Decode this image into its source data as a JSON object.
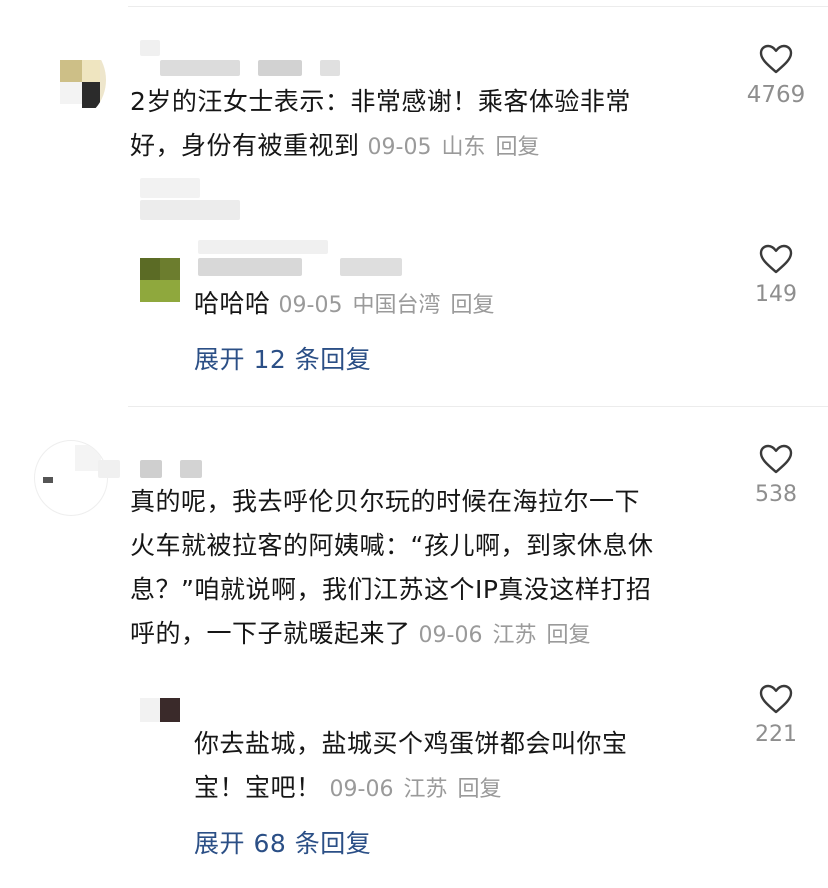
{
  "comments": [
    {
      "text": "2岁的汪女士表示：非常感谢！乘客体验非常好，身份有被重视到",
      "line1": "2岁的汪女士表示：非常感谢！乘客体验非常",
      "line2": "好，身份有被重视到",
      "date": "09-05",
      "location": "山东",
      "reply_label": "回复",
      "likes": "4769",
      "reply": {
        "text": "哈哈哈",
        "date": "09-05",
        "location": "中国台湾",
        "reply_label": "回复",
        "likes": "149"
      },
      "expand_label": "展开 12 条回复"
    },
    {
      "line1": "真的呢，我去呼伦贝尔玩的时候在海拉尔一下",
      "line2": "火车就被拉客的阿姨喊：“孩儿啊，到家休息休",
      "line3": "息？”咱就说啊，我们江苏这个IP真没这样打招",
      "line4": "呼的，一下子就暖起来了",
      "date": "09-06",
      "location": "江苏",
      "reply_label": "回复",
      "likes": "538",
      "reply": {
        "line1": "你去盐城，盐城买个鸡蛋饼都会叫你宝",
        "line2": "宝！宝吧！",
        "date": "09-06",
        "location": "江苏",
        "reply_label": "回复",
        "likes": "221"
      },
      "expand_label": "展开 68 条回复"
    }
  ],
  "icons": {
    "like": "heart-outline-icon"
  },
  "colors": {
    "link": "#2b4f86",
    "meta": "#9a9a9a",
    "text": "#161616"
  }
}
